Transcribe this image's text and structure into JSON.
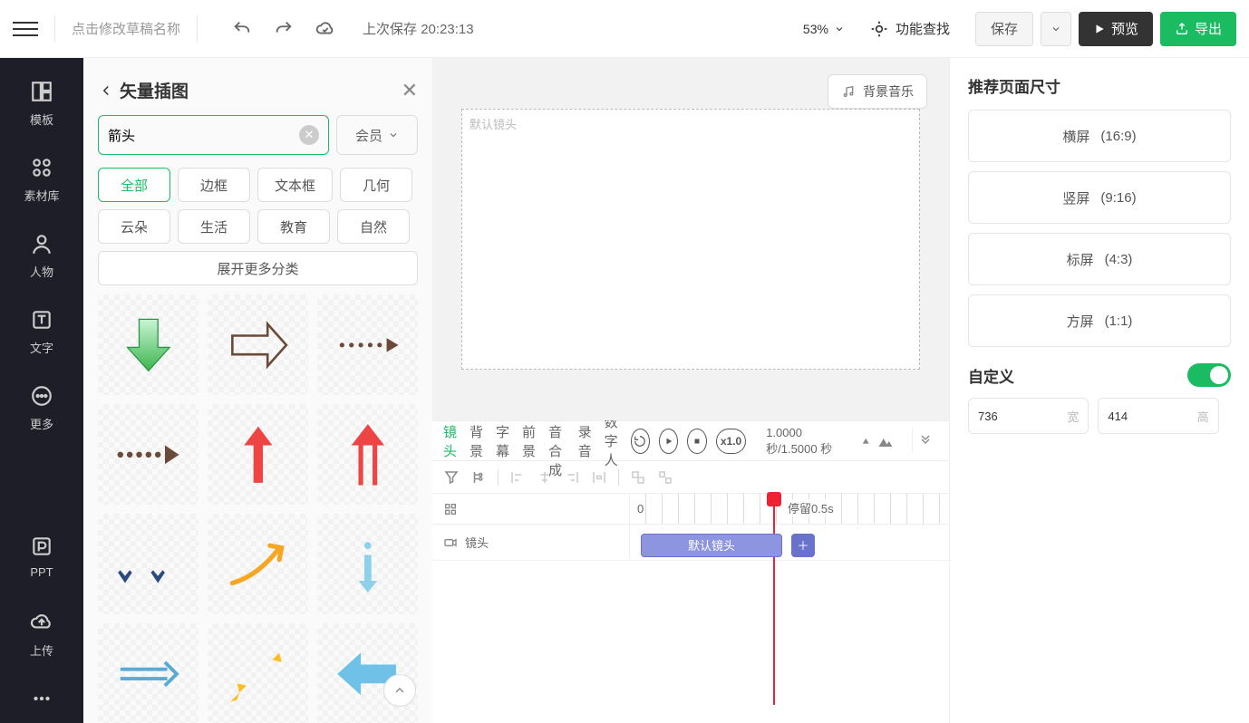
{
  "topbar": {
    "draft_name": "点击修改草稿名称",
    "last_save_prefix": "上次保存",
    "last_save_time": "20:23:13",
    "zoom": "53%",
    "function_find": "功能查找",
    "save": "保存",
    "preview": "预览",
    "export": "导出"
  },
  "sidebar": {
    "items": [
      "模板",
      "素材库",
      "人物",
      "文字",
      "更多"
    ],
    "bottom": [
      "PPT",
      "上传"
    ]
  },
  "asset_panel": {
    "title": "矢量插图",
    "search_value": "箭头",
    "member": "会员",
    "categories": [
      "全部",
      "边框",
      "文本框",
      "几何",
      "云朵",
      "生活",
      "教育",
      "自然"
    ],
    "expand": "展开更多分类"
  },
  "canvas": {
    "bg_music": "背景音乐",
    "stage_label": "默认镜头"
  },
  "timeline": {
    "tabs": [
      "镜头",
      "背景",
      "字幕",
      "前景",
      "语音合成",
      "录音",
      "数字人"
    ],
    "speed": "x1.0",
    "time": "1.0000 秒/1.5000 秒",
    "ruler_start": "0",
    "stay_label": "停留0.5s",
    "track_label": "镜头",
    "clip_label": "默认镜头"
  },
  "inspector": {
    "heading": "推荐页面尺寸",
    "presets": [
      {
        "name": "横屏",
        "ratio": "(16:9)"
      },
      {
        "name": "竖屏",
        "ratio": "(9:16)"
      },
      {
        "name": "标屏",
        "ratio": "(4:3)"
      },
      {
        "name": "方屏",
        "ratio": "(1:1)"
      }
    ],
    "custom": "自定义",
    "width": "736",
    "width_lbl": "宽",
    "height": "414",
    "height_lbl": "高"
  }
}
